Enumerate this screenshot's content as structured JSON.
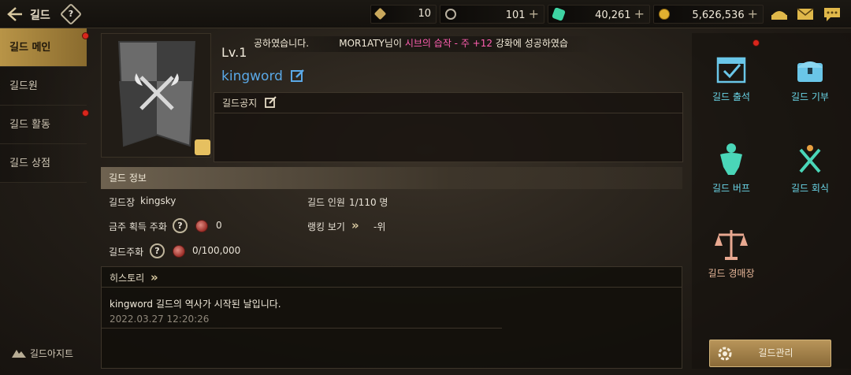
{
  "header": {
    "title": "길드",
    "help": "?"
  },
  "resources": [
    {
      "name": "sword-token",
      "value": "10",
      "plus": "",
      "color": "#c9a85c"
    },
    {
      "name": "silver-coin",
      "value": "101",
      "plus": "+",
      "color": "#b8b0a0"
    },
    {
      "name": "green-gem",
      "value": "40,261",
      "plus": "+",
      "color": "#3ed3a2"
    },
    {
      "name": "gold-coin",
      "value": "5,626,536",
      "plus": "+",
      "color": "#e0b030"
    }
  ],
  "sidebar": {
    "items": [
      {
        "label": "길드 메인",
        "active": true,
        "badge": true
      },
      {
        "label": "길드원",
        "active": false,
        "badge": false
      },
      {
        "label": "길드 활동",
        "active": false,
        "badge": true
      },
      {
        "label": "길드 상점",
        "active": false,
        "badge": false
      }
    ],
    "hideout": "길드아지트"
  },
  "guild": {
    "level": "Lv.1",
    "name": "kingword",
    "notice_label": "길드공지",
    "notice_text": ""
  },
  "ticker": {
    "prefix": "공하였습니다.",
    "player": "MOR1ATY님이",
    "item": "시브의 습작 - 주 +12",
    "suffix": "강화에 성공하였습"
  },
  "info": {
    "header": "길드 정보",
    "leader_label": "길드장",
    "leader_value": "kingsky",
    "members_label": "길드 인원",
    "members_value": "1/110 명",
    "weekly_label": "금주 획득 주화",
    "weekly_value": "0",
    "ranking_label": "랭킹 보기",
    "ranking_value": "-위",
    "coin_label": "길드주화",
    "coin_value": "0/100,000"
  },
  "history": {
    "header": "히스토리",
    "entries": [
      {
        "text": "kingword 길드의 역사가 시작된 날입니다.",
        "time": "2022.03.27 12:20:26"
      }
    ]
  },
  "right_menu": {
    "attendance": "길드 출석",
    "donation": "길드 기부",
    "buff": "길드 버프",
    "dinner": "길드 회식",
    "auction": "길드 경매장"
  },
  "manage_button": "길드관리"
}
